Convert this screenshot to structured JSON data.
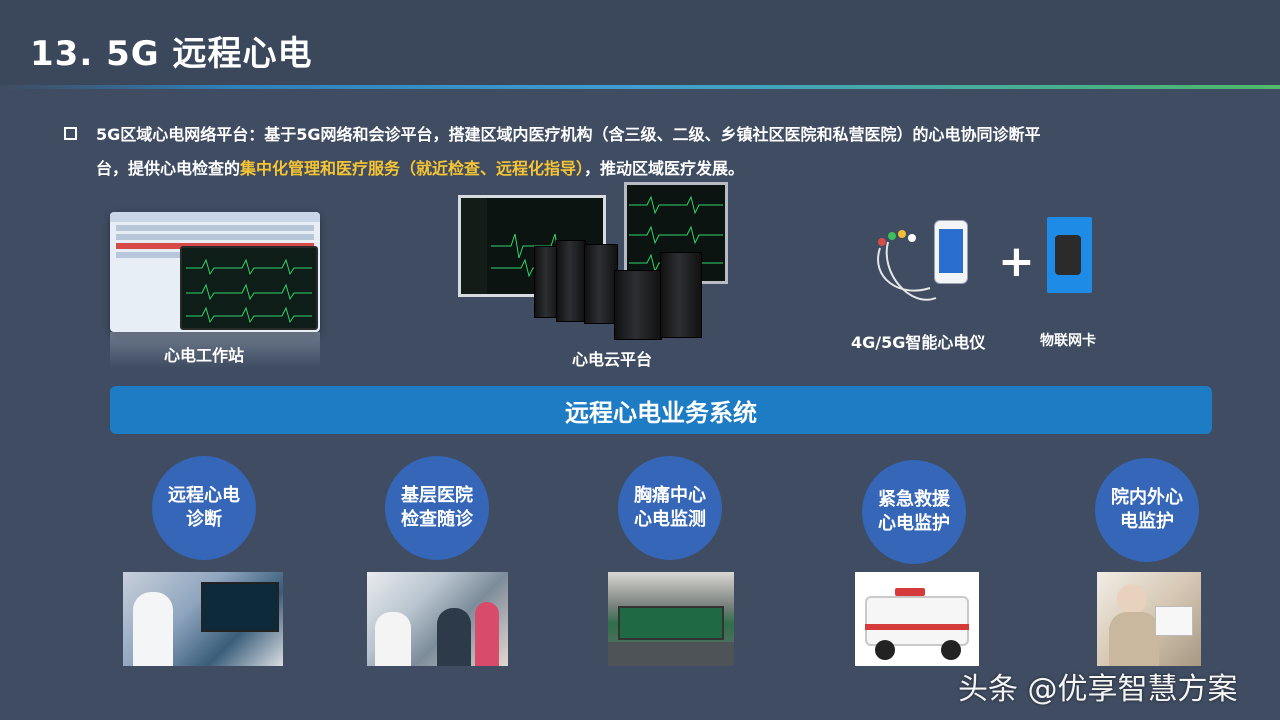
{
  "slide": {
    "title": "13. 5G 远程心电"
  },
  "intro": {
    "prefix": "5G区域心电网络平台：基于5G网络和会诊平台，搭建区域内医疗机构（含三级、二级、乡镇社区医院和私营医院）的心电协同诊断平",
    "line2_start": "台，提供心电检查的",
    "highlight": "集中化管理和医疗服务（就近检查、远程化指导）",
    "line2_end": "，推动区域医疗发展。"
  },
  "devices": {
    "workstation_label": "心电工作站",
    "cloud_label": "心电云平台",
    "ecg_device_label": "4G/5G智能心电仪",
    "plus": "+",
    "sim_label": "物联网卡"
  },
  "banner": {
    "label": "远程心电业务系统"
  },
  "services": [
    {
      "label": "远程心电诊断"
    },
    {
      "label": "基层医院检查随诊"
    },
    {
      "label": "胸痛中心心电监测"
    },
    {
      "label": "紧急救援心电监护"
    },
    {
      "label": "院内外心电监护"
    }
  ],
  "watermark": "头条 @优享智慧方案",
  "colors": {
    "background": "#3f4c61",
    "highlight": "#f7c533",
    "banner": "#1e7cc4",
    "circle": "#3566b7"
  },
  "icons": {
    "bullet": "square-bullet-icon"
  }
}
